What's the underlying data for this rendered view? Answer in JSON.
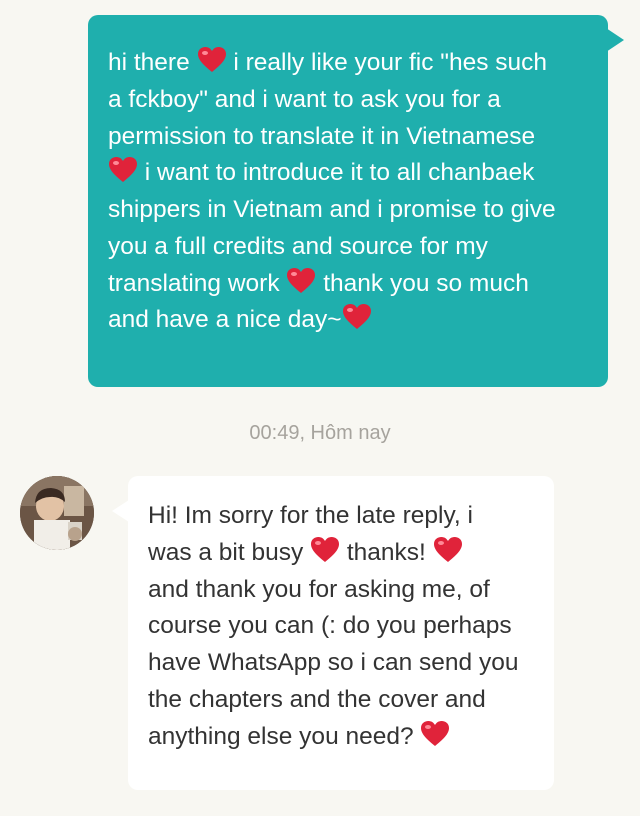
{
  "outgoing_message": {
    "lines": [
      [
        "hi there ",
        "heart",
        " i really like your fic \"hes such"
      ],
      [
        "a fckboy\" and i want to ask you for a"
      ],
      [
        "permission to translate it in Vietnamese"
      ],
      [
        "heart",
        " i want to introduce it to all chanbaek"
      ],
      [
        "shippers in Vietnam and i promise to give"
      ],
      [
        "you a full credits and source for my"
      ],
      [
        "translating work ",
        "heart",
        " thank you so much"
      ],
      [
        "and have a nice day~",
        "heart"
      ]
    ],
    "bubble_color": "#1fafad",
    "text_color": "#ffffff"
  },
  "timestamp": "00:49, Hôm nay",
  "incoming_message": {
    "avatar_icon": "user-avatar",
    "lines": [
      [
        "Hi! Im sorry for the late reply, i"
      ],
      [
        "was a bit busy ",
        "heart",
        " thanks! ",
        "heart"
      ],
      [
        "and thank you for asking me, of"
      ],
      [
        "course you can (: do you perhaps"
      ],
      [
        "have WhatsApp so i can send you"
      ],
      [
        "the chapters and the cover and"
      ],
      [
        "anything else you need? ",
        "heart"
      ]
    ],
    "bubble_color": "#ffffff",
    "text_color": "#333333"
  },
  "icons": {
    "heart": "heart-emoji-icon",
    "heart_color": "#e0233a"
  }
}
